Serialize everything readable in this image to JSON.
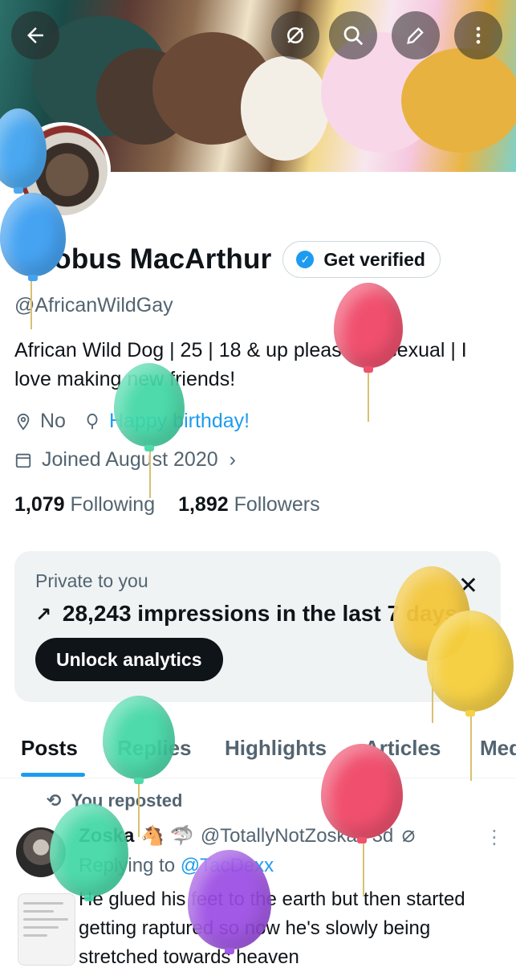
{
  "header": {
    "back_label": "Back",
    "icons": [
      "arrow-left-icon",
      "sync-off-icon",
      "search-icon",
      "edit-icon",
      "more-vertical-icon"
    ]
  },
  "profile": {
    "name": "Iacobus MacArthur",
    "get_verified": "Get verified",
    "handle": "@AfricanWildGay",
    "bio": "African Wild Dog | 25 | 18 & up please | Bisexual | I love making new friends!",
    "location": "No",
    "birthday": "Happy birthday!",
    "joined": "Joined August 2020",
    "following_count": "1,079",
    "following_label": "Following",
    "followers_count": "1,892",
    "followers_label": "Followers"
  },
  "analytics": {
    "private_label": "Private to you",
    "impressions": "28,243 impressions in the last 7 days",
    "unlock_label": "Unlock analytics"
  },
  "tabs": [
    "Posts",
    "Replies",
    "Highlights",
    "Articles",
    "Media"
  ],
  "post": {
    "reposted_label": "You reposted",
    "author": "Zoska",
    "author_emoji": "🐴 🦈",
    "handle": "@TotallyNotZoska",
    "time": "· 3d",
    "replying_prefix": "Replying to",
    "replying_handle": "@TacDexx",
    "text": "He glued his feet to the earth but then started getting raptured so now he's slowly being stretched towards heaven"
  },
  "colors": {
    "accent": "#1d9bf0",
    "text": "#0f1419",
    "muted": "#536471",
    "card_bg": "#eff3f4"
  }
}
